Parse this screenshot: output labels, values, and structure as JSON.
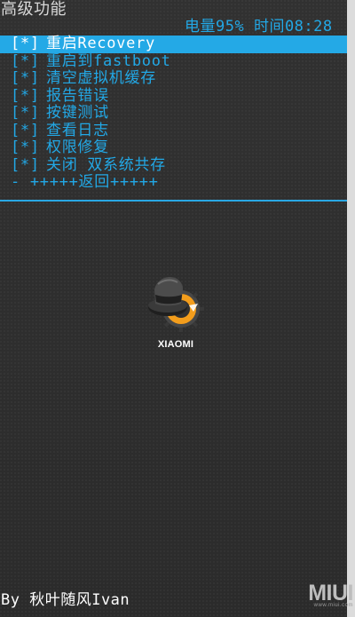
{
  "header": {
    "title": "高级功能",
    "status_text": "电量95% 时间08:28"
  },
  "menu": {
    "items": [
      {
        "bracket": "[*]",
        "label": "重启Recovery"
      },
      {
        "bracket": "[*]",
        "label": "重启到fastboot"
      },
      {
        "bracket": "[*]",
        "label": "清空虚拟机缓存"
      },
      {
        "bracket": "[*]",
        "label": "报告错误"
      },
      {
        "bracket": "[*]",
        "label": "按键测试"
      },
      {
        "bracket": "[*]",
        "label": "查看日志"
      },
      {
        "bracket": "[*]",
        "label": "权限修复"
      },
      {
        "bracket": "[*]",
        "label": "关闭 双系统共存"
      }
    ],
    "back_label": "- +++++返回+++++"
  },
  "logo": {
    "text": "XIAOMI",
    "icon_name": "clockworkmod-hat-icon"
  },
  "footer": {
    "credit": "By 秋叶随风Ivan"
  },
  "watermark": {
    "brand": "MIUI",
    "url": "www.miui.com"
  },
  "colors": {
    "accent": "#24a9e6",
    "background": "#2f2f30",
    "text": "#ffffff"
  }
}
